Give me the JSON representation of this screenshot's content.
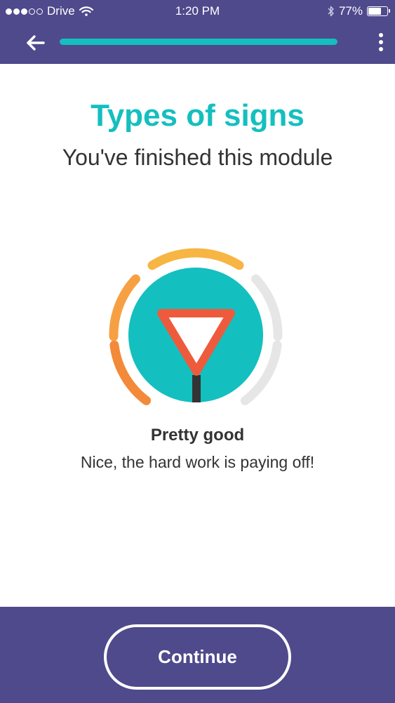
{
  "status_bar": {
    "carrier": "Drive",
    "time": "1:20 PM",
    "battery_text": "77%",
    "battery_level": 0.77,
    "signal_bars_filled": 3,
    "signal_bars_total": 5
  },
  "header": {
    "back_icon": "arrow-left-icon",
    "more_icon": "vertical-dots-icon",
    "module_progress": 1.0
  },
  "main": {
    "title": "Types of signs",
    "subtitle": "You've finished this module",
    "result_title": "Pretty good",
    "result_text": "Nice, the hard work is paying off!",
    "score_icon": "yield-sign-icon",
    "score_segments_filled": 3,
    "score_segments_total": 6
  },
  "footer": {
    "continue_label": "Continue"
  },
  "colors": {
    "header_bg": "#4f4a8c",
    "accent_teal": "#14bfbf",
    "sign_red": "#ee5b3c",
    "seg_orange": "#f28a3a",
    "seg_light_orange": "#f7a043",
    "seg_yellow": "#f7b544",
    "seg_empty": "#e6e6e6",
    "text_dark": "#333333"
  }
}
